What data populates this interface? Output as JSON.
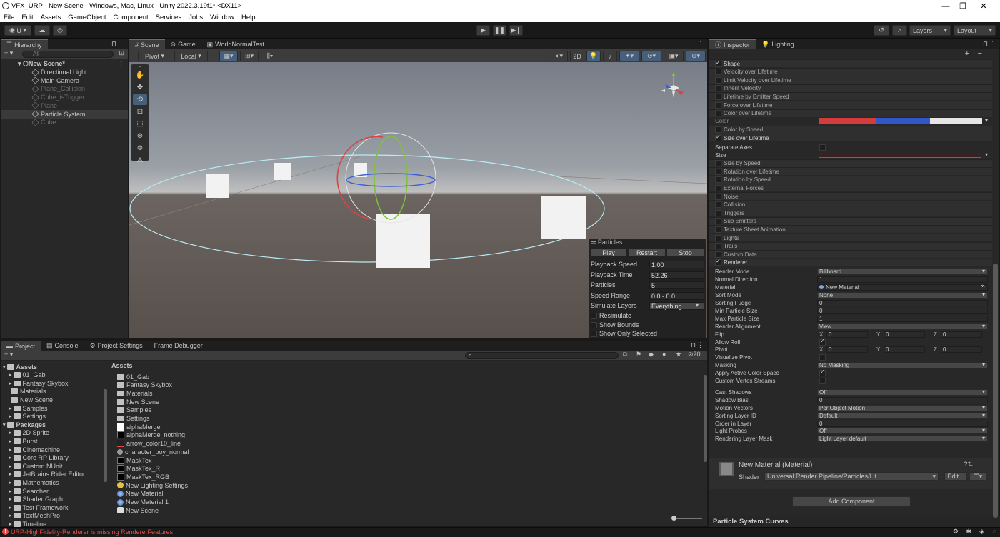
{
  "window": {
    "title": "VFX_URP - New Scene - Windows, Mac, Linux - Unity 2022.3.19f1* <DX11>",
    "minimize": "—",
    "maximize": "❐",
    "close": "✕"
  },
  "menu": [
    "File",
    "Edit",
    "Assets",
    "GameObject",
    "Component",
    "Services",
    "Jobs",
    "Window",
    "Help"
  ],
  "toolbar": {
    "account": "U",
    "layers": "Layers",
    "layout": "Layout"
  },
  "hierarchy": {
    "tab": "Hierarchy",
    "search_placeholder": "All",
    "scene": "New Scene*",
    "items": [
      {
        "name": "Directional Light",
        "dim": false
      },
      {
        "name": "Main Camera",
        "dim": false
      },
      {
        "name": "Plane_Collision",
        "dim": true
      },
      {
        "name": "Cube_isTrigger",
        "dim": true
      },
      {
        "name": "Plane",
        "dim": true
      },
      {
        "name": "Particle System",
        "dim": false,
        "selected": true
      },
      {
        "name": "Cube",
        "dim": true
      }
    ]
  },
  "scene_tabs": [
    "Scene",
    "Game",
    "WorldNormalTest"
  ],
  "scene_toolbar": {
    "pivot": "Pivot",
    "local": "Local",
    "mode_2d": "2D"
  },
  "particles": {
    "title": "Particles",
    "play": "Play",
    "restart": "Restart",
    "stop": "Stop",
    "rows": [
      {
        "label": "Playback Speed",
        "value": "1.00"
      },
      {
        "label": "Playback Time",
        "value": "52.26"
      },
      {
        "label": "Particles",
        "value": "5"
      },
      {
        "label": "Speed Range",
        "value": "0.0 - 0.0"
      },
      {
        "label": "Simulate Layers",
        "value": "Everything"
      }
    ],
    "checks": [
      "Resimulate",
      "Show Bounds",
      "Show Only Selected"
    ]
  },
  "bottom_tabs": [
    "Project",
    "Console",
    "Project Settings",
    "Frame Debugger"
  ],
  "project": {
    "count": "20",
    "tree": [
      {
        "name": "Assets",
        "level": 0,
        "bold": true
      },
      {
        "name": "01_Gab",
        "level": 1
      },
      {
        "name": "Fantasy Skybox",
        "level": 1
      },
      {
        "name": "Materials",
        "level": 1
      },
      {
        "name": "New Scene",
        "level": 1
      },
      {
        "name": "Samples",
        "level": 1
      },
      {
        "name": "Settings",
        "level": 1
      },
      {
        "name": "Packages",
        "level": 0,
        "bold": true
      },
      {
        "name": "2D Sprite",
        "level": 1
      },
      {
        "name": "Burst",
        "level": 1
      },
      {
        "name": "Cinemachine",
        "level": 1
      },
      {
        "name": "Core RP Library",
        "level": 1
      },
      {
        "name": "Custom NUnit",
        "level": 1
      },
      {
        "name": "JetBrains Rider Editor",
        "level": 1
      },
      {
        "name": "Mathematics",
        "level": 1
      },
      {
        "name": "Searcher",
        "level": 1
      },
      {
        "name": "Shader Graph",
        "level": 1
      },
      {
        "name": "Test Framework",
        "level": 1
      },
      {
        "name": "TextMeshPro",
        "level": 1
      },
      {
        "name": "Timeline",
        "level": 1
      }
    ],
    "breadcrumb": "Assets",
    "assets": [
      {
        "name": "01_Gab",
        "kind": "folder"
      },
      {
        "name": "Fantasy Skybox",
        "kind": "folder"
      },
      {
        "name": "Materials",
        "kind": "folder"
      },
      {
        "name": "New Scene",
        "kind": "folder"
      },
      {
        "name": "Samples",
        "kind": "folder"
      },
      {
        "name": "Settings",
        "kind": "folder"
      },
      {
        "name": "alphaMerge",
        "kind": "tex-white"
      },
      {
        "name": "alphaMerge_nothing",
        "kind": "tex-black"
      },
      {
        "name": "arrow_color10_line",
        "kind": "tex-red"
      },
      {
        "name": "character_boy_normal",
        "kind": "prefab"
      },
      {
        "name": "MaskTex",
        "kind": "tex-black"
      },
      {
        "name": "MaskTex_R",
        "kind": "tex-black"
      },
      {
        "name": "MaskTex_RGB",
        "kind": "tex-black"
      },
      {
        "name": "New Lighting Settings",
        "kind": "lighting"
      },
      {
        "name": "New Material",
        "kind": "material"
      },
      {
        "name": "New Material 1",
        "kind": "material"
      },
      {
        "name": "New Scene",
        "kind": "scene"
      }
    ]
  },
  "inspector": {
    "tabs": [
      "Inspector",
      "Lighting"
    ],
    "modules_a": [
      {
        "name": "Shape",
        "on": true
      },
      {
        "name": "Velocity over Lifetime",
        "on": false
      },
      {
        "name": "Limit Velocity over Lifetime",
        "on": false
      },
      {
        "name": "Inherit Velocity",
        "on": false
      },
      {
        "name": "Lifetime by Emitter Speed",
        "on": false
      },
      {
        "name": "Force over Lifetime",
        "on": false
      },
      {
        "name": "Color over Lifetime",
        "on": false
      }
    ],
    "color_label": "Color",
    "modules_b": [
      {
        "name": "Color by Speed",
        "on": false
      },
      {
        "name": "Size over Lifetime",
        "on": true
      }
    ],
    "separate_axes": "Separate Axes",
    "size_label": "Size",
    "modules_c": [
      {
        "name": "Size by Speed",
        "on": false
      },
      {
        "name": "Rotation over Lifetime",
        "on": false
      },
      {
        "name": "Rotation by Speed",
        "on": false
      },
      {
        "name": "External Forces",
        "on": false
      },
      {
        "name": "Noise",
        "on": false
      },
      {
        "name": "Collision",
        "on": false
      },
      {
        "name": "Triggers",
        "on": false
      },
      {
        "name": "Sub Emitters",
        "on": false
      },
      {
        "name": "Texture Sheet Animation",
        "on": false
      },
      {
        "name": "Lights",
        "on": false
      },
      {
        "name": "Trails",
        "on": false
      },
      {
        "name": "Custom Data",
        "on": false
      },
      {
        "name": "Renderer",
        "on": true
      }
    ],
    "renderer": [
      {
        "label": "Render Mode",
        "value": "Billboard",
        "type": "dd"
      },
      {
        "label": "Normal Direction",
        "value": "1",
        "type": "fld"
      },
      {
        "label": "Material",
        "value": "New Material",
        "type": "obj"
      },
      {
        "label": "Sort Mode",
        "value": "None",
        "type": "dd"
      },
      {
        "label": "Sorting Fudge",
        "value": "0",
        "type": "fld"
      },
      {
        "label": "Min Particle Size",
        "value": "0",
        "type": "fld"
      },
      {
        "label": "Max Particle Size",
        "value": "1",
        "type": "fld"
      },
      {
        "label": "Render Alignment",
        "value": "View",
        "type": "dd"
      },
      {
        "label": "Flip",
        "value": "",
        "type": "xyz"
      },
      {
        "label": "Allow Roll",
        "value": "",
        "type": "chk"
      },
      {
        "label": "Pivot",
        "value": "",
        "type": "xyz"
      },
      {
        "label": "Visualize Pivot",
        "value": "",
        "type": "chk0"
      },
      {
        "label": "Masking",
        "value": "No Masking",
        "type": "dd"
      },
      {
        "label": "Apply Active Color Space",
        "value": "",
        "type": "chk"
      },
      {
        "label": "Custom Vertex Streams",
        "value": "",
        "type": "chk0"
      }
    ],
    "xyz_values": {
      "x": "X",
      "y": "Y",
      "z": "Z",
      "v": "0"
    },
    "renderer2": [
      {
        "label": "Cast Shadows",
        "value": "Off",
        "type": "dd"
      },
      {
        "label": "Shadow Bias",
        "value": "0",
        "type": "fld"
      },
      {
        "label": "Motion Vectors",
        "value": "Per Object Motion",
        "type": "dd"
      },
      {
        "label": "Sorting Layer ID",
        "value": "Default",
        "type": "dd"
      },
      {
        "label": "Order in Layer",
        "value": "0",
        "type": "fld"
      },
      {
        "label": "Light Probes",
        "value": "Off",
        "type": "dd"
      },
      {
        "label": "Rendering Layer Mask",
        "value": "Light Layer default",
        "type": "dd"
      }
    ],
    "material_title": "New Material (Material)",
    "shader_label": "Shader",
    "shader_value": "Universal Render Pipeline/Particles/Lit",
    "edit": "Edit...",
    "add_component": "Add Component",
    "curves": "Particle System Curves"
  },
  "status": {
    "message": "URP-HighFidelity-Renderer is missing RendererFeatures",
    "color": "#e24a4a"
  }
}
